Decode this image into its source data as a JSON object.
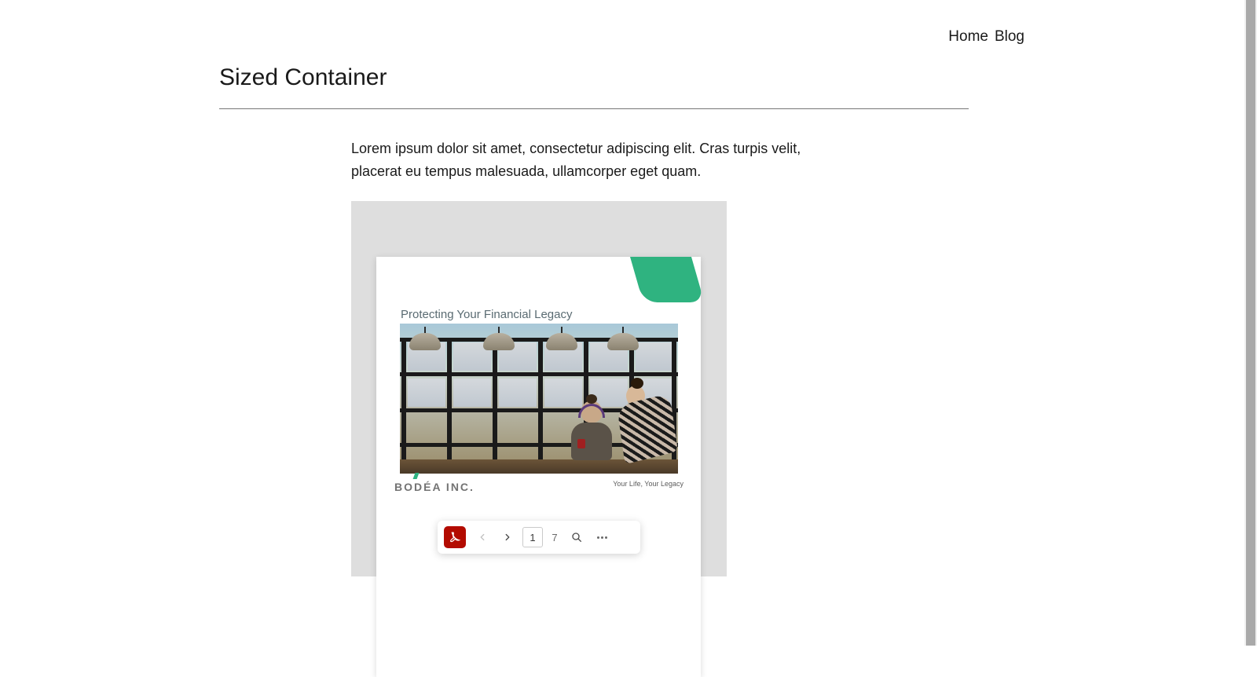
{
  "nav": {
    "home": "Home",
    "blog": "Blog"
  },
  "page": {
    "title": "Sized Container",
    "body_text": "Lorem ipsum dolor sit amet, consectetur adipiscing elit. Cras turpis velit, placerat eu tempus malesuada, ullamcorper eget quam."
  },
  "pdf": {
    "heading": "Protecting Your Financial Legacy",
    "brand": "BODÉA INC.",
    "tagline": "Your Life, Your Legacy",
    "toolbar": {
      "current_page": "1",
      "total_pages": "7"
    }
  }
}
